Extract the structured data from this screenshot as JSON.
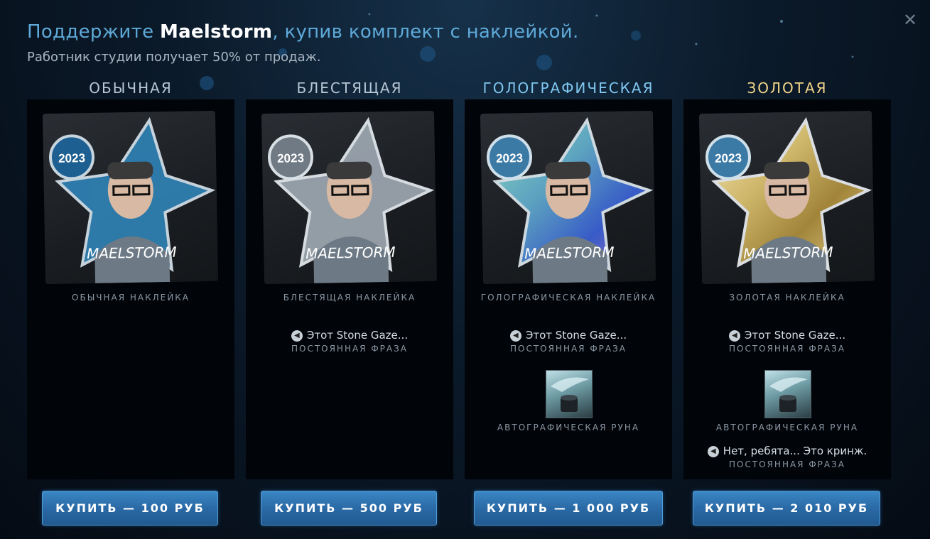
{
  "header": {
    "title_prefix": "Поддержите ",
    "title_name": "Maelstorm",
    "title_suffix": ", купив комплект с наклейкой.",
    "subtitle": "Работник студии получает 50% от продаж."
  },
  "columns": [
    {
      "heading": "ОБЫЧНАЯ",
      "sticker_label": "ОБЫЧНАЯ НАКЛЕЙКА",
      "buy_label": "КУПИТЬ — 100 РУБ"
    },
    {
      "heading": "БЛЕСТЯЩАЯ",
      "sticker_label": "БЛЕСТЯЩАЯ НАКЛЕЙКА",
      "phrase": "Этот Stone Gaze...",
      "phrase_sub": "ПОСТОЯННАЯ ФРАЗА",
      "buy_label": "КУПИТЬ — 500 РУБ"
    },
    {
      "heading": "ГОЛОГРАФИЧЕСКАЯ",
      "sticker_label": "ГОЛОГРАФИЧЕСКАЯ НАКЛЕЙКА",
      "phrase": "Этот Stone Gaze...",
      "phrase_sub": "ПОСТОЯННАЯ ФРАЗА",
      "rune_label": "АВТОГРАФИЧЕСКАЯ РУНА",
      "buy_label": "КУПИТЬ — 1 000 РУБ"
    },
    {
      "heading": "ЗОЛОТАЯ",
      "sticker_label": "ЗОЛОТАЯ НАКЛЕЙКА",
      "phrase": "Этот Stone Gaze...",
      "phrase_sub": "ПОСТОЯННАЯ ФРАЗА",
      "rune_label": "АВТОГРАФИЧЕСКАЯ РУНА",
      "phrase2": "Нет, ребята... Это кринж.",
      "phrase2_sub": "ПОСТОЯННАЯ ФРАЗА",
      "buy_label": "КУПИТЬ — 2 010 РУБ"
    }
  ],
  "sticker": {
    "year": "2023",
    "signature": "MAELSTORM"
  },
  "colors": {
    "accent_blue": "#5ea9d8",
    "gold": "#f2d58a",
    "button": "#2a6aa6",
    "normal_star": "#2f7fb0",
    "shiny_star": "#9aa4ad",
    "holo_star": "#5fa7c9",
    "gold_star": "#d9c070"
  },
  "icons": {
    "close": "close-icon",
    "speaker": "speaker-icon"
  }
}
